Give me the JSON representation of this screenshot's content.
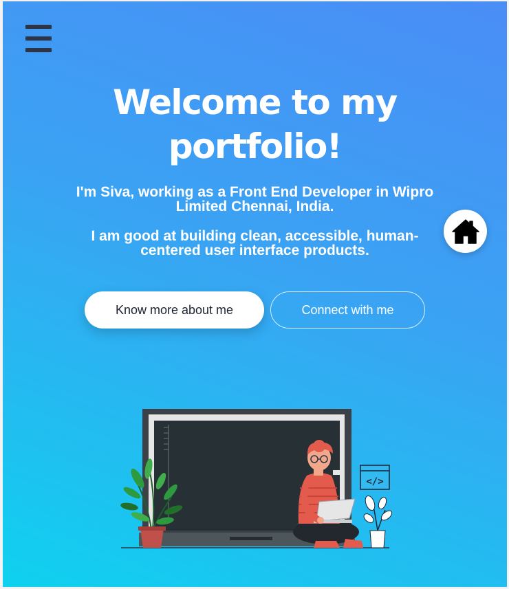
{
  "header": {
    "menu_icon": "hamburger-menu-icon",
    "home_icon": "home-icon"
  },
  "hero": {
    "title_line1": "Welcome to my",
    "title_line2": "portfolio!",
    "intro": "I'm Siva, working as a Front End Developer in Wipro Limited Chennai, India.",
    "skills": "I am good at building clean, accessible, human-centered user interface products."
  },
  "actions": {
    "primary_label": "Know more about me",
    "secondary_label": "Connect with me"
  },
  "illustration": {
    "code_icon_text": "</>"
  },
  "colors": {
    "gradient_top": "#4a8df6",
    "gradient_bottom": "#0fd1ef",
    "accent": "#f26b5b",
    "dark": "#2c3446"
  }
}
